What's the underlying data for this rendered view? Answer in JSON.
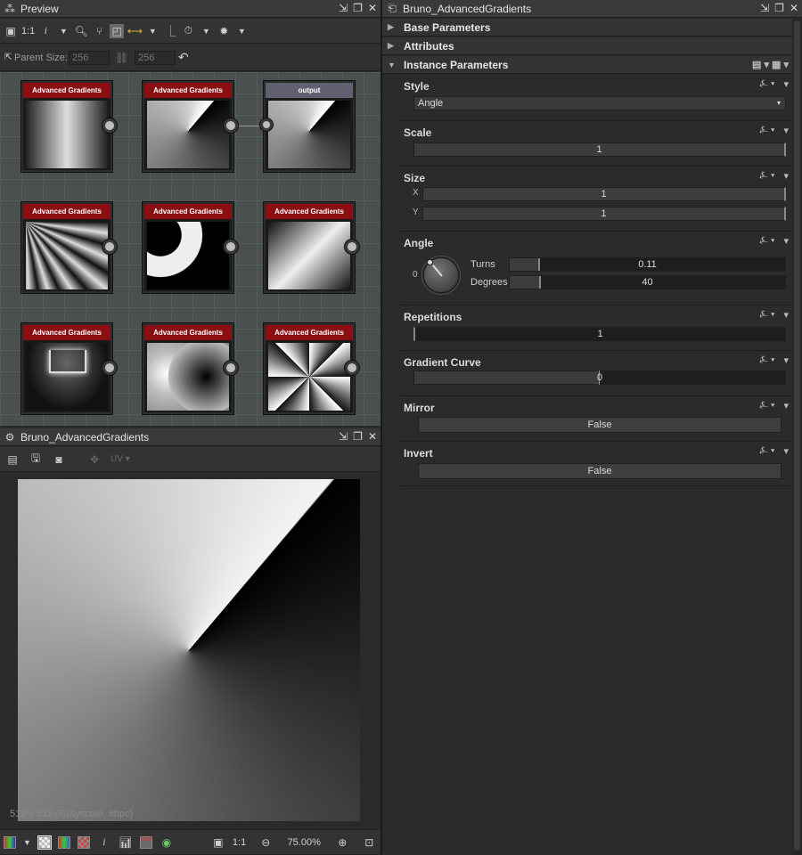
{
  "preview_panel": {
    "title": "Preview",
    "parent_size_label": "Parent Size:",
    "width_value": "256",
    "height_value": "256",
    "toolbar_zoom_label": "1:1",
    "toolbar_info_label": "i"
  },
  "nodes": [
    {
      "label": "Advanced Gradients",
      "pattern": "vertical"
    },
    {
      "label": "Advanced Gradients",
      "pattern": "angle"
    },
    {
      "label": "output",
      "pattern": "angle"
    },
    {
      "label": "Advanced Gradients",
      "pattern": "rays"
    },
    {
      "label": "Advanced Gradients",
      "pattern": "arc"
    },
    {
      "label": "Advanced Gradients",
      "pattern": "diagonal"
    },
    {
      "label": "Advanced Gradients",
      "pattern": "tunnel"
    },
    {
      "label": "Advanced Gradients",
      "pattern": "spots"
    },
    {
      "label": "Advanced Gradients",
      "pattern": "star"
    }
  ],
  "view_panel": {
    "title": "Bruno_AdvancedGradients",
    "uv_label": "UV",
    "image_info": "512 x 512 (Grayscale, 8bpc)",
    "zoom_label": "1:1",
    "zoom_value": "75.00%",
    "info_label": "i"
  },
  "params_panel": {
    "title": "Bruno_AdvancedGradients",
    "sections": {
      "base": "Base Parameters",
      "attributes": "Attributes",
      "instance": "Instance Parameters"
    },
    "style": {
      "label": "Style",
      "value": "Angle"
    },
    "scale": {
      "label": "Scale",
      "value": "1"
    },
    "size": {
      "label": "Size",
      "x_label": "X",
      "x_value": "1",
      "y_label": "Y",
      "y_value": "1"
    },
    "angle": {
      "label": "Angle",
      "dial_zero": "0",
      "turns_label": "Turns",
      "turns_value": "0.11",
      "degrees_label": "Degrees",
      "degrees_value": "40"
    },
    "repetitions": {
      "label": "Repetitions",
      "value": "1"
    },
    "gradient_curve": {
      "label": "Gradient Curve",
      "value": "0"
    },
    "mirror": {
      "label": "Mirror",
      "value": "False"
    },
    "invert": {
      "label": "Invert",
      "value": "False"
    }
  },
  "colors": {
    "node_header": "#8a0e12",
    "output_header": "#606070",
    "panel_bg": "#2b2b2b",
    "graph_bg": "#4a5050"
  }
}
